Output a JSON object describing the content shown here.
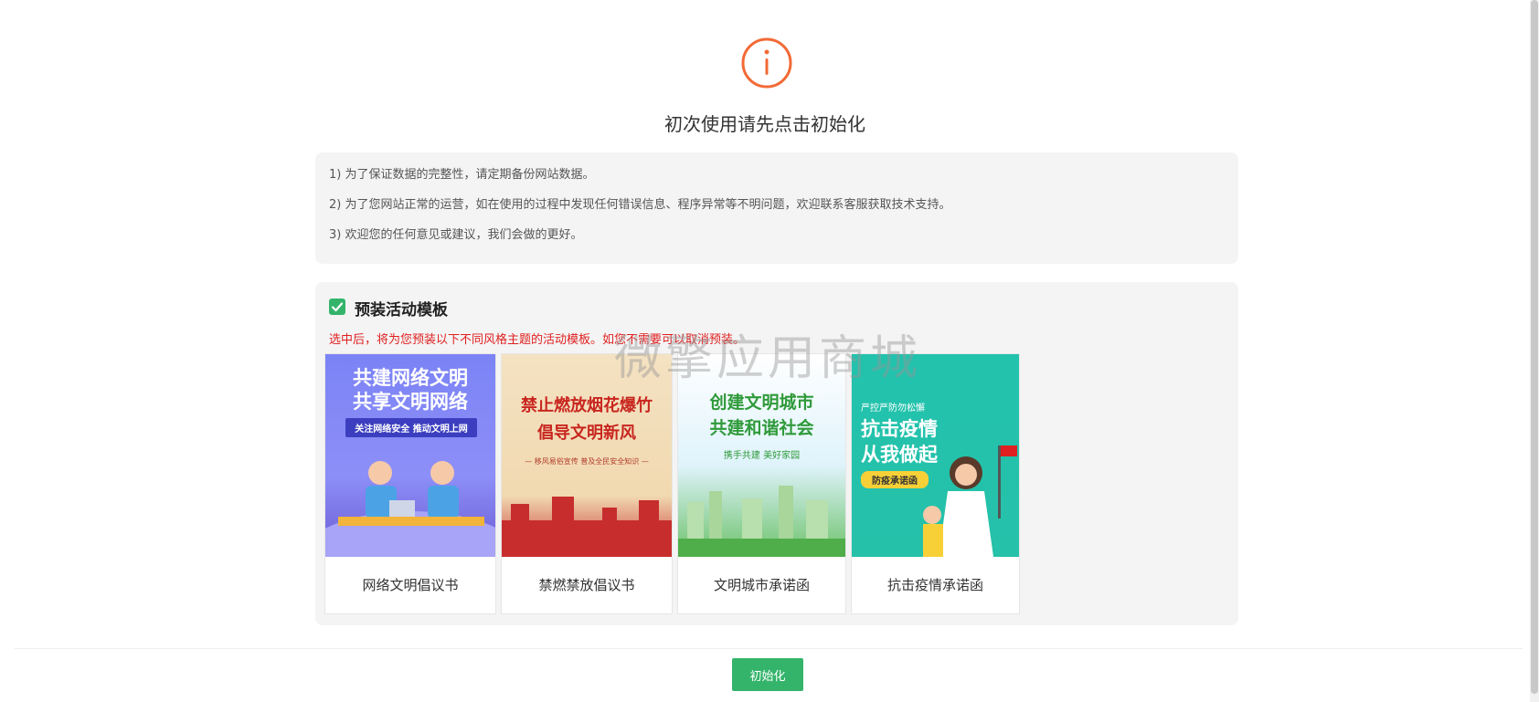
{
  "page": {
    "title": "初次使用请先点击初始化"
  },
  "notices": [
    "1) 为了保证数据的完整性，请定期备份网站数据。",
    "2) 为了您网站正常的运营，如在使用的过程中发现任何错误信息、程序异常等不明问题，欢迎联系客服获取技术支持。",
    "3) 欢迎您的任何意见或建议，我们会做的更好。"
  ],
  "templates": {
    "title": "预装活动模板",
    "hint": "选中后，将为您预装以下不同风格主题的活动模板。如您不需要可以取消预装。",
    "items": [
      {
        "label": "网络文明倡议书",
        "poster_line1": "共建网络文明",
        "poster_line2": "共享文明网络",
        "poster_tag": "关注网络安全  推动文明上网"
      },
      {
        "label": "禁燃禁放倡议书",
        "poster_line1": "禁止燃放烟花爆竹",
        "poster_line2": "倡导文明新风",
        "poster_tag": "— 移风易俗宣传  普及全民安全知识 —"
      },
      {
        "label": "文明城市承诺函",
        "poster_line1": "创建文明城市",
        "poster_line2": "共建和谐社会",
        "poster_tag": "携手共建  美好家园"
      },
      {
        "label": "抗击疫情承诺函",
        "poster_line1": "抗击疫情",
        "poster_line2": "从我做起",
        "poster_tag": "防疫承诺函",
        "poster_top": "严控严防勿松懈"
      }
    ]
  },
  "watermark": "微擎应用商城",
  "actions": {
    "init_label": "初始化"
  },
  "colors": {
    "accent": "#34b46b",
    "warning": "#e02020",
    "icon": "#f26a36"
  },
  "icons": [
    "info-circle-icon",
    "checkbox-checked-icon"
  ]
}
